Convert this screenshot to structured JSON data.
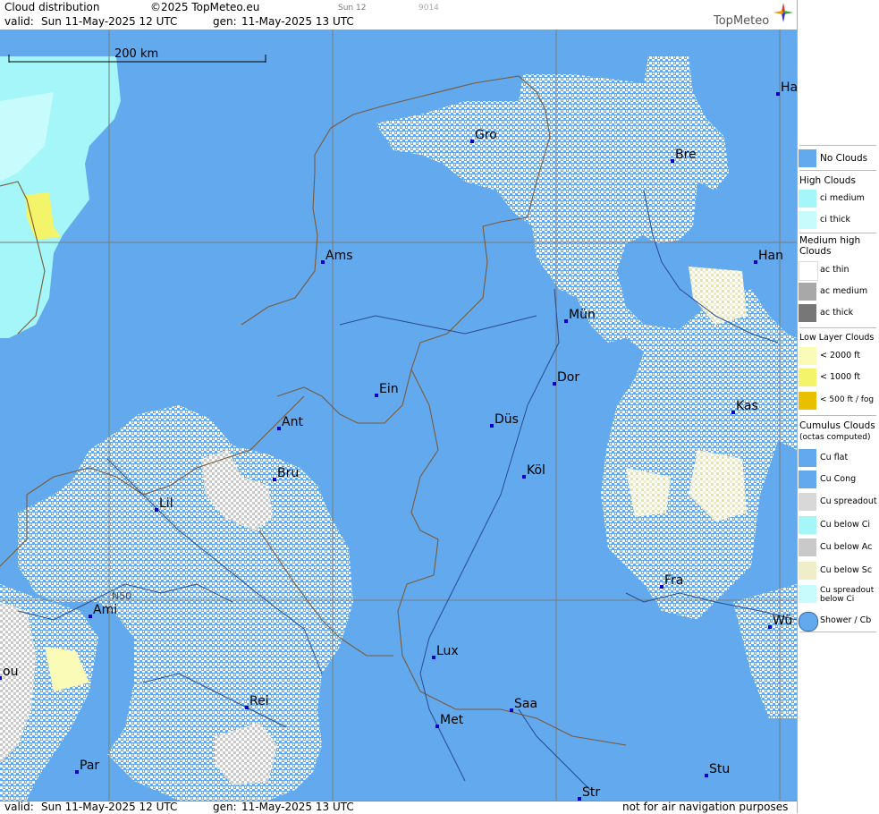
{
  "header": {
    "title": "Cloud distribution",
    "copyright": "©2025 TopMeteo.eu",
    "day": "Sun 12",
    "code": "9014",
    "valid_label": "valid:",
    "valid_value": "Sun  11-May-2025  12 UTC",
    "gen_label": "gen:",
    "gen_value": "11-May-2025 13 UTC",
    "brand": "TopMeteo"
  },
  "footer": {
    "valid_label": "valid:",
    "valid_value": "Sun  11-May-2025  12 UTC",
    "gen_label": "gen:",
    "gen_value": "11-May-2025 13 UTC",
    "notice": "not for air navigation purposes"
  },
  "map": {
    "scale_label": "200 km",
    "latitude_label": "N50",
    "cities": [
      "Gro",
      "Bre",
      "Ha",
      "Ams",
      "Han",
      "Mün",
      "Dor",
      "Ein",
      "Ant",
      "Düs",
      "Kas",
      "Bru",
      "Köl",
      "Lil",
      "Fra",
      "Ami",
      "Wü",
      "Lux",
      "ou",
      "Rei",
      "Saa",
      "Met",
      "Par",
      "Stu",
      "Str"
    ],
    "colors": {
      "no_clouds": "#62a9ee",
      "ci_medium": "#a4f6f8",
      "ci_thick": "#c8fbfc",
      "cu_flat": "#ffffff",
      "cu_below_ac": "#c9c9c9",
      "cu_below_sc": "#eeeec8",
      "low_2000": "#fbfbb8",
      "low_1000": "#f4f46a",
      "borders": "#8a6a4a",
      "rivers": "#2a4a8a"
    }
  },
  "legend": {
    "no_clouds": "No Clouds",
    "high_title": "High Clouds",
    "ci_medium": "ci medium",
    "ci_thick": "ci thick",
    "medium_title": "Medium high Clouds",
    "ac_thin": "ac thin",
    "ac_medium": "ac medium",
    "ac_thick": "ac thick",
    "low_title": "Low Layer Clouds",
    "low_2000": "< 2000 ft",
    "low_1000": "< 1000 ft",
    "low_500": "< 500 ft / fog",
    "cumulus_title": "Cumulus Clouds",
    "cumulus_sub": "(octas computed)",
    "cu_flat": "Cu flat",
    "cu_cong": "Cu Cong",
    "cu_spreadout": "Cu spreadout",
    "cu_below_ci": "Cu below Ci",
    "cu_below_ac": "Cu below Ac",
    "cu_below_sc": "Cu below Sc",
    "cu_spreadout_ci": "Cu spreadout below Ci",
    "shower": "Shower / Cb"
  }
}
